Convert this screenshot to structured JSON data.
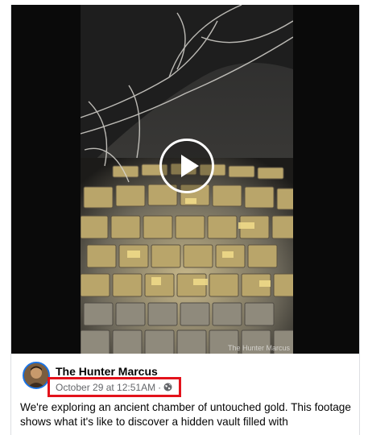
{
  "video": {
    "watermark": "The Hunter Marcus",
    "play_icon": "play-icon"
  },
  "post": {
    "author": "The Hunter Marcus",
    "timestamp": "October 29 at 12:51AM",
    "separator": "·",
    "privacy_icon": "globe-icon",
    "caption": "We're exploring an ancient chamber of untouched gold. This footage shows what it's like to discover a hidden vault filled with"
  },
  "colors": {
    "highlight_border": "#e3121b",
    "avatar_ring": "#1b74e4",
    "meta_text": "#65676b"
  }
}
